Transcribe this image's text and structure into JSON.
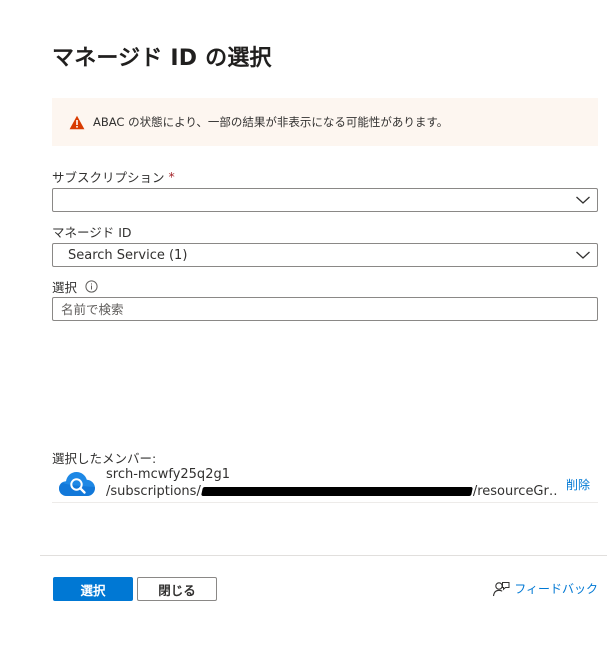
{
  "title": "マネージド ID の選択",
  "warning": {
    "icon": "warning-icon",
    "text": "ABAC の状態により、一部の結果が非表示になる可能性があります。",
    "color": "#d83b01"
  },
  "subscription": {
    "label": "サブスクリプション",
    "required_mark": "*",
    "value": ""
  },
  "managed_id": {
    "label": "マネージド ID",
    "value": "Search Service (1)"
  },
  "select": {
    "label": "選択",
    "info_icon": "info-icon",
    "placeholder": "名前で検索",
    "value": ""
  },
  "selected_members": {
    "label": "選択したメンバー:",
    "items": [
      {
        "icon": "cloud-search-icon",
        "name": "srch-mcwfy25q2g1",
        "path_prefix": "/subscriptions/",
        "path_suffix": "/resourceGr…",
        "remove_label": "削除"
      }
    ]
  },
  "footer": {
    "select_button": "選択",
    "close_button": "閉じる",
    "feedback_label": "フィードバック",
    "feedback_icon": "feedback-icon"
  },
  "colors": {
    "accent": "#0078d4",
    "required": "#a4262c",
    "warning_bg": "#fdf6f0"
  }
}
